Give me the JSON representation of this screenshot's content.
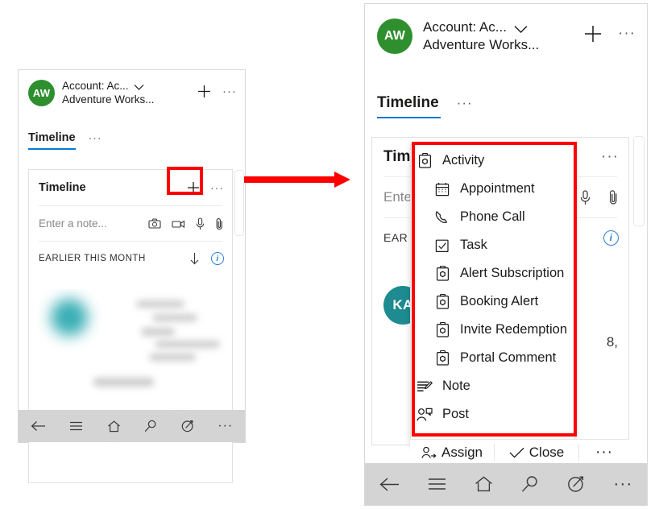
{
  "left_phone": {
    "header": {
      "avatar_initials": "AW",
      "avatar_color": "#2f8f2f",
      "title_line1": "Account: Ac...",
      "title_line2": "Adventure Works...",
      "chevron_icon": "chevron-down-icon",
      "add_icon": "plus-icon",
      "overflow_icon": "more-horizontal-icon"
    },
    "pivot": {
      "tab_label": "Timeline",
      "overflow_icon": "more-horizontal-icon"
    },
    "card": {
      "title": "Timeline",
      "add_icon": "plus-icon",
      "overflow_icon": "more-horizontal-icon",
      "note_placeholder": "Enter a note...",
      "note_icons": [
        "camera-icon",
        "video-icon",
        "microphone-icon",
        "paperclip-icon"
      ],
      "group_label": "EARLIER THIS MONTH",
      "sort_icon": "arrow-down-icon",
      "info_icon": "info-icon",
      "info_glyph": "i"
    },
    "navbar": {
      "icons": [
        "back-arrow-icon",
        "hamburger-icon",
        "home-icon",
        "search-icon",
        "compass-icon",
        "more-horizontal-icon"
      ]
    }
  },
  "arrow": {
    "color": "#ff0000",
    "direction": "right"
  },
  "right_phone": {
    "header": {
      "avatar_initials": "AW",
      "avatar_color": "#2f8f2f",
      "title_line1": "Account: Ac...",
      "title_line2": "Adventure Works...",
      "chevron_icon": "chevron-down-icon",
      "add_icon": "plus-icon",
      "overflow_icon": "more-horizontal-icon"
    },
    "pivot": {
      "tab_label": "Timeline",
      "overflow_icon": "more-horizontal-icon"
    },
    "card": {
      "title_clipped": "Tim",
      "overflow_icon": "more-horizontal-icon",
      "note_placeholder_clipped": "Ente",
      "note_icons": [
        "microphone-icon",
        "paperclip-icon"
      ],
      "group_label_clipped": "EAR",
      "info_icon": "info-icon",
      "info_glyph": "i",
      "record_avatar_initials": "KA",
      "record_avatar_color": "#1d8b8f",
      "record_text_fragment": "8,"
    },
    "menu": {
      "items": [
        {
          "label": "Activity",
          "icon": "activity-clipboard-icon",
          "indent": false
        },
        {
          "label": "Appointment",
          "icon": "calendar-icon",
          "indent": true
        },
        {
          "label": "Phone Call",
          "icon": "phone-icon",
          "indent": true
        },
        {
          "label": "Task",
          "icon": "task-checkbox-icon",
          "indent": true
        },
        {
          "label": "Alert Subscription",
          "icon": "activity-clipboard-icon",
          "indent": true
        },
        {
          "label": "Booking Alert",
          "icon": "activity-clipboard-icon",
          "indent": true
        },
        {
          "label": "Invite Redemption",
          "icon": "activity-clipboard-icon",
          "indent": true
        },
        {
          "label": "Portal Comment",
          "icon": "activity-clipboard-icon",
          "indent": true
        },
        {
          "label": "Note",
          "icon": "note-icon",
          "indent": false
        },
        {
          "label": "Post",
          "icon": "post-person-icon",
          "indent": false
        }
      ]
    },
    "command_bar": {
      "assign_label": "Assign",
      "assign_icon": "assign-person-icon",
      "close_label": "Close",
      "close_icon": "check-icon",
      "overflow_icon": "more-horizontal-icon"
    },
    "navbar": {
      "icons": [
        "back-arrow-icon",
        "hamburger-icon",
        "home-icon",
        "search-icon",
        "compass-icon",
        "more-horizontal-icon"
      ]
    }
  }
}
